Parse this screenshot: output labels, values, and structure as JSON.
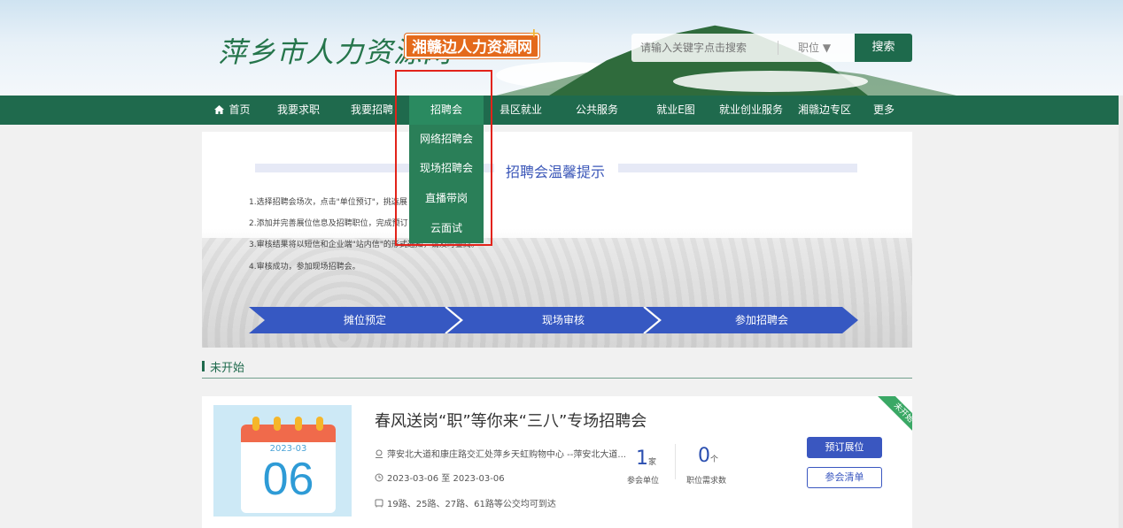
{
  "header": {
    "logo_main": "萍乡市人力资源网",
    "logo_badge": "湘赣边人力资源网",
    "logo_plus": "+",
    "search_placeholder": "请输入关键字点击搜索",
    "search_category": "职位 ▼",
    "search_button": "搜索"
  },
  "nav": {
    "items": [
      "首页",
      "我要求职",
      "我要招聘",
      "招聘会",
      "县区就业",
      "公共服务",
      "就业E图",
      "就业创业服务",
      "湘赣边专区",
      "更多"
    ],
    "active_index": 3
  },
  "dropdown": {
    "items": [
      "网络招聘会",
      "现场招聘会",
      "直播带岗",
      "云面试"
    ]
  },
  "banner": {
    "title": "招聘会温馨提示",
    "steps": [
      "1.选择招聘会场次，点击\"单位预订\"，挑选展",
      "2.添加并完善展位信息及招聘职位，完成预订",
      "3.审核结果将以短信和企业端\"站内信\"的形式通知，请及时查阅。",
      "4.审核成功，参加现场招聘会。"
    ],
    "flow": [
      "摊位预定",
      "现场审核",
      "参加招聘会"
    ]
  },
  "section": {
    "title": "未开始"
  },
  "fair": {
    "calendar_ym": "2023-03",
    "calendar_day": "06",
    "title": "春风送岗“职”等你来“三八”专场招聘会",
    "address": "萍安北大道和康庄路交汇处萍乡天虹购物中心 --萍安北大道...",
    "date_range": "2023-03-06 至 2023-03-06",
    "transport": "19路、25路、27路、61路等公交均可到达",
    "units_count": "1",
    "units_unit": "家",
    "units_label": "参会单位",
    "jobs_count": "0",
    "jobs_unit": "个",
    "jobs_label": "职位需求数",
    "btn_book": "预订展位",
    "btn_list": "参会清单",
    "ribbon": "未开始"
  },
  "colors": {
    "nav_bg": "#1f6a4d",
    "accent_blue": "#3a57c0",
    "highlight_red": "#e2231a"
  }
}
